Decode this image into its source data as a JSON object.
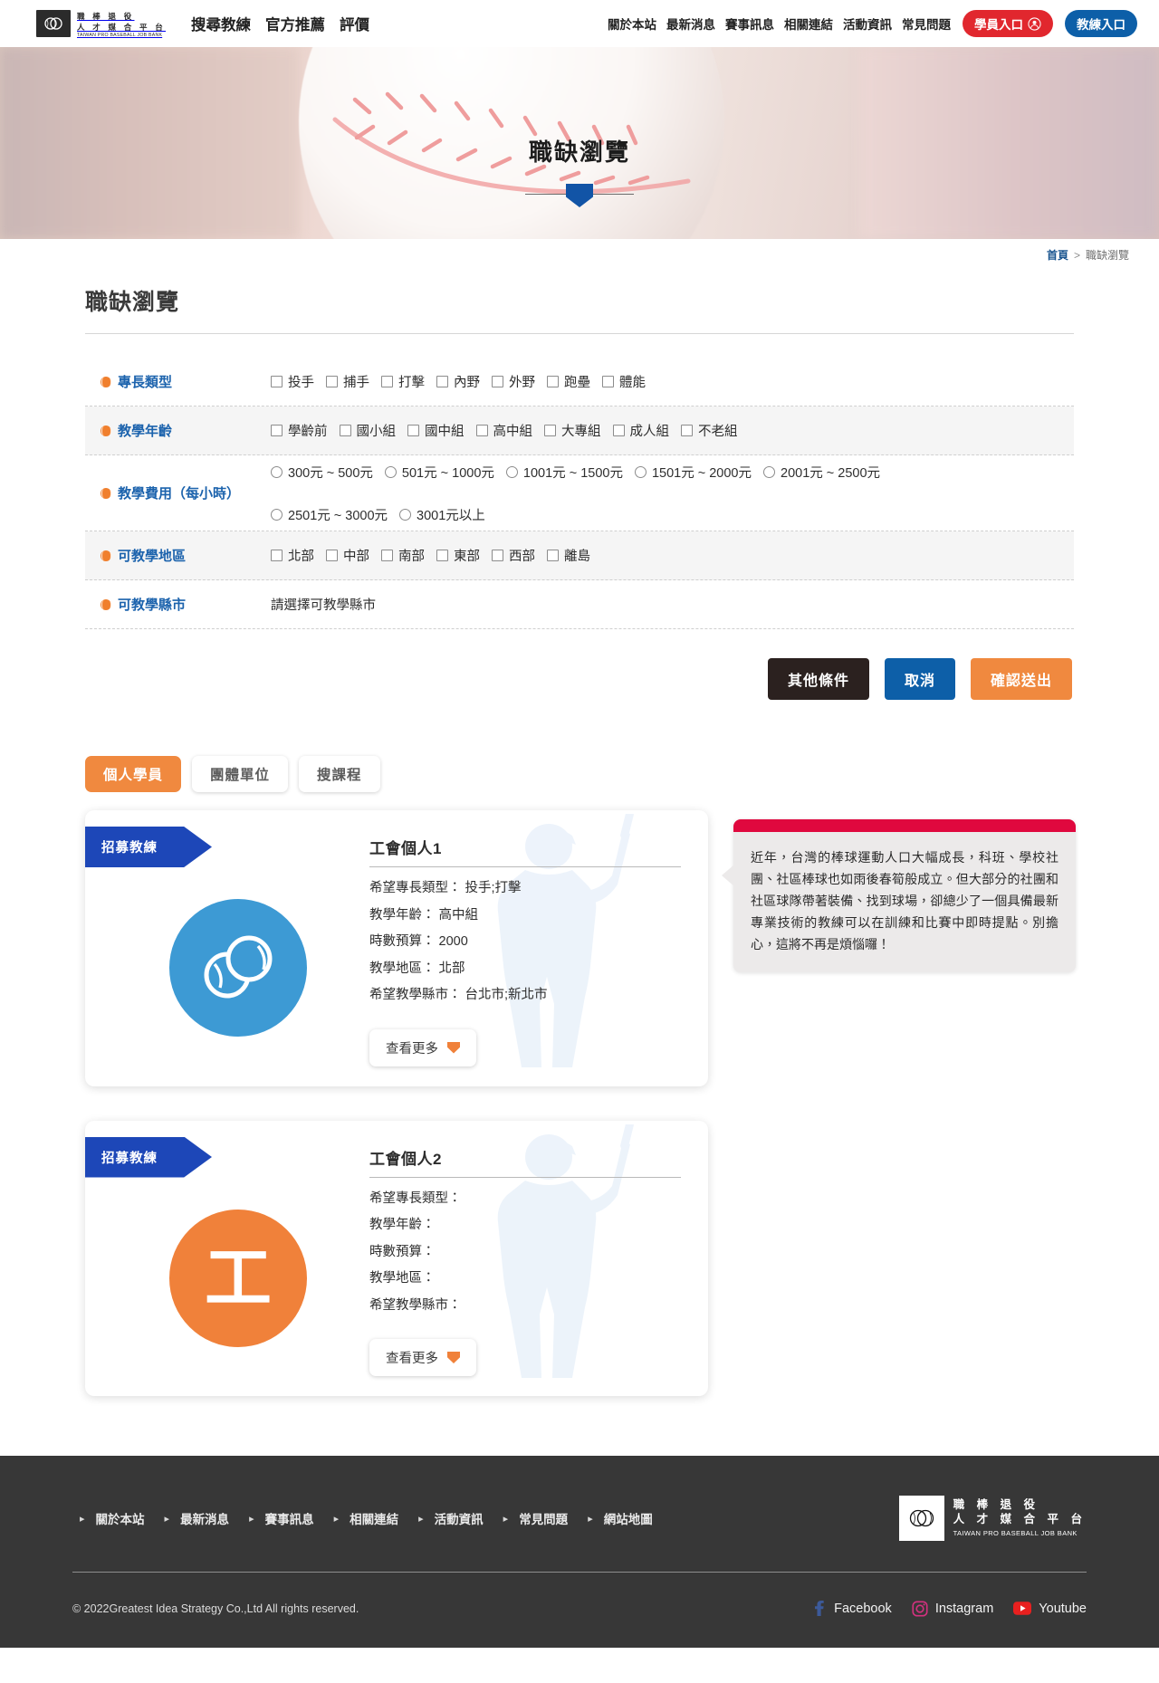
{
  "header": {
    "logo": {
      "line1": "職 棒 退 役",
      "line2": "人 才 媒 合 平 台",
      "line3": "TAIWAN PRO BASEBALL JOB BANK"
    },
    "nav_left": [
      "搜尋教練",
      "官方推薦",
      "評價"
    ],
    "nav_right": [
      "關於本站",
      "最新消息",
      "賽事訊息",
      "相關連結",
      "活動資訊",
      "常見問題"
    ],
    "student_portal": "學員入口",
    "coach_portal": "教練入口"
  },
  "hero": {
    "title": "職缺瀏覽"
  },
  "breadcrumb": {
    "home": "首頁",
    "separator": ">",
    "current": "職缺瀏覽"
  },
  "page": {
    "title": "職缺瀏覽"
  },
  "filters": [
    {
      "label": "專長類型",
      "type": "checkbox",
      "options": [
        "投手",
        "捕手",
        "打擊",
        "內野",
        "外野",
        "跑壘",
        "體能"
      ]
    },
    {
      "label": "教學年齡",
      "type": "checkbox",
      "options": [
        "學齡前",
        "國小組",
        "國中組",
        "高中組",
        "大專組",
        "成人組",
        "不老組"
      ]
    },
    {
      "label": "教學費用（每小時）",
      "type": "radio",
      "options": [
        "300元 ~ 500元",
        "501元 ~ 1000元",
        "1001元 ~ 1500元",
        "1501元 ~ 2000元",
        "2001元 ~ 2500元",
        "2501元 ~ 3000元",
        "3001元以上"
      ]
    },
    {
      "label": "可教學地區",
      "type": "checkbox",
      "options": [
        "北部",
        "中部",
        "南部",
        "東部",
        "西部",
        "離島"
      ]
    },
    {
      "label": "可教學縣市",
      "type": "text",
      "placeholder_text": "請選擇可教學縣市"
    }
  ],
  "actions": {
    "other": "其他條件",
    "cancel": "取消",
    "submit": "確認送出"
  },
  "tabs": [
    {
      "label": "個人學員",
      "active": true
    },
    {
      "label": "團體單位",
      "active": false
    },
    {
      "label": "搜課程",
      "active": false
    }
  ],
  "field_labels": {
    "specialty": "希望專長類型：",
    "age": "教學年齡：",
    "budget": "時數預算：",
    "area": "教學地區：",
    "city": "希望教學縣市："
  },
  "cards": [
    {
      "ribbon": "招募教練",
      "title": "工會個人1",
      "avatar_kind": "baseball",
      "specialty": "投手;打擊",
      "age": "高中組",
      "budget": "2000",
      "area": "北部",
      "city": "台北市;新北市",
      "more": "查看更多"
    },
    {
      "ribbon": "招募教練",
      "title": "工會個人2",
      "avatar_kind": "letter",
      "avatar_letter": "工",
      "specialty": "",
      "age": "",
      "budget": "",
      "area": "",
      "city": "",
      "more": "查看更多"
    }
  ],
  "bubble": {
    "text": "近年，台灣的棒球運動人口大幅成長，科班、學校社團、社區棒球也如雨後春筍般成立。但大部分的社團和社區球隊帶著裝備、找到球場，卻總少了一個具備最新專業技術的教練可以在訓練和比賽中即時提點。別擔心，這將不再是煩惱囉！"
  },
  "footer": {
    "links": [
      "關於本站",
      "最新消息",
      "賽事訊息",
      "相關連結",
      "活動資訊",
      "常見問題",
      "網站地圖"
    ],
    "logo": {
      "line1": "職 棒 退 役",
      "line2": "人 才 媒 合 平 台",
      "line3": "TAIWAN PRO BASEBALL JOB BANK"
    },
    "copyright": "© 2022Greatest Idea Strategy Co.,Ltd All rights reserved.",
    "socials": [
      {
        "name": "Facebook",
        "color": "#3c5a9a"
      },
      {
        "name": "Instagram",
        "color": "#d4317f"
      },
      {
        "name": "Youtube",
        "color": "#e8201f"
      }
    ]
  },
  "colors": {
    "accent_orange": "#f0893f",
    "accent_blue": "#0d5fa8",
    "ribbon_blue": "#1d47b8",
    "bubble_red": "#e0083e",
    "student_red": "#e1272e"
  }
}
